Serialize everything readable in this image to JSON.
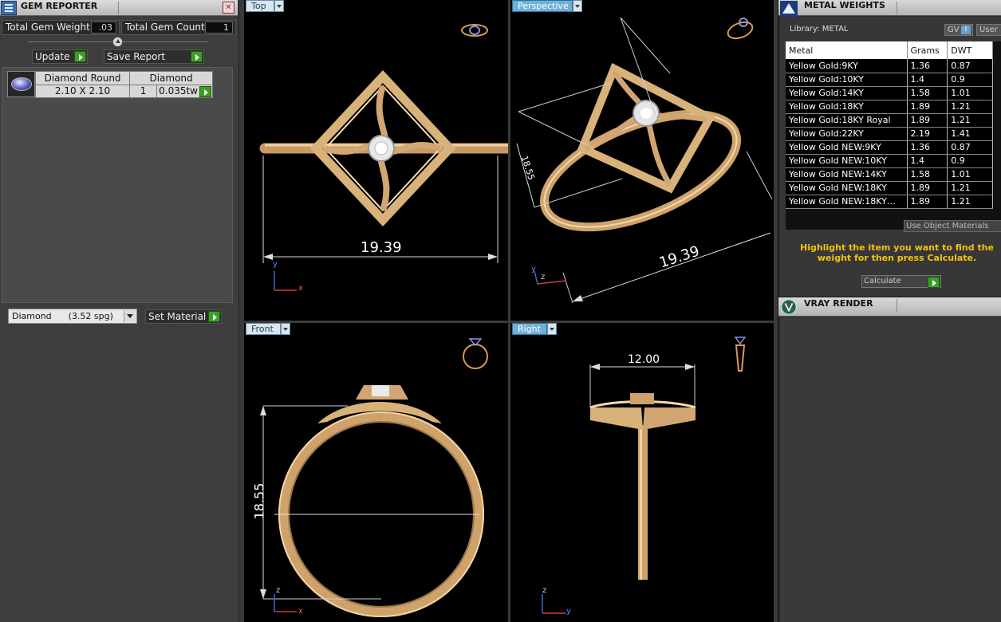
{
  "gem_reporter": {
    "title": "GEM REPORTER",
    "total_weight_label": "Total Gem Weight",
    "total_weight_value": ".03",
    "total_count_label": "Total Gem Count",
    "total_count_value": "1",
    "update_label": "Update",
    "save_report_label": "Save Report",
    "gem_row": {
      "shape": "Diamond Round",
      "type": "Diamond",
      "size": "2.10 X 2.10",
      "count": "1",
      "weight": "0.035tw"
    },
    "material_select": "Diamond      (3.52 spg)",
    "set_material_label": "Set Material"
  },
  "viewports": {
    "top": {
      "label": "Top",
      "dimension": "19.39"
    },
    "perspective": {
      "label": "Perspective",
      "dimension_a": "19.39",
      "dimension_b": "18.55"
    },
    "front": {
      "label": "Front",
      "dimension": "18.55"
    },
    "right": {
      "label": "Right",
      "dimension": "12.00"
    },
    "axes": {
      "x": "x",
      "y": "y",
      "z": "z"
    }
  },
  "metal_weights": {
    "title": "METAL WEIGHTS",
    "library": "Library: METAL",
    "gv_label": "GV",
    "user_label": "User",
    "columns": [
      "Metal",
      "Grams",
      "DWT"
    ],
    "rows": [
      [
        "Yellow Gold:9KY",
        "1.36",
        "0.87"
      ],
      [
        "Yellow Gold:10KY",
        "1.4",
        "0.9"
      ],
      [
        "Yellow Gold:14KY",
        "1.58",
        "1.01"
      ],
      [
        "Yellow Gold:18KY",
        "1.89",
        "1.21"
      ],
      [
        "Yellow Gold:18KY Royal",
        "1.89",
        "1.21"
      ],
      [
        "Yellow Gold:22KY",
        "2.19",
        "1.41"
      ],
      [
        "Yellow Gold NEW:9KY",
        "1.36",
        "0.87"
      ],
      [
        "Yellow Gold NEW:10KY",
        "1.4",
        "0.9"
      ],
      [
        "Yellow Gold NEW:14KY",
        "1.58",
        "1.01"
      ],
      [
        "Yellow Gold NEW:18KY",
        "1.89",
        "1.21"
      ],
      [
        "Yellow Gold NEW:18KY…",
        "1.89",
        "1.21"
      ]
    ],
    "use_object_materials": "Use Object Materials",
    "hint": "Highlight the item you want to find the weight for then press Calculate.",
    "calculate_label": "Calculate"
  },
  "vray": {
    "title": "VRAY RENDER"
  },
  "colors": {
    "gold": "#d9b27a",
    "accent_green": "#3aa024",
    "hint_yellow": "#f4c20d"
  }
}
